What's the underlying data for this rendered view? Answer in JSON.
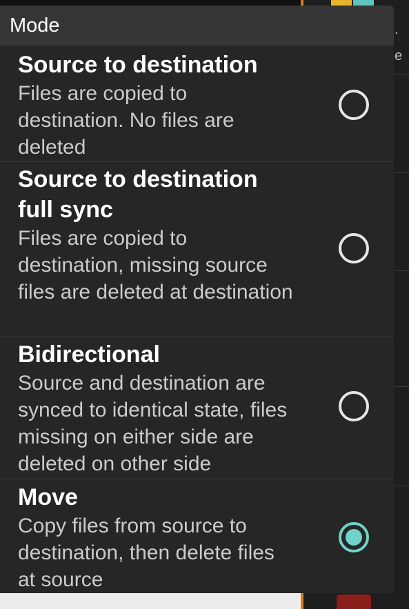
{
  "dialog": {
    "title": "Mode"
  },
  "options": [
    {
      "title": "Source to destination",
      "description": "Files are copied to destination. No files are deleted",
      "selected": false
    },
    {
      "title": "Source to destination full sync",
      "description": "Files are copied to destination, missing source files are deleted at destination",
      "selected": false
    },
    {
      "title": "Bidirectional",
      "description": "Source and destination are synced to identical state, files missing on either side are deleted on other side",
      "selected": false
    },
    {
      "title": "Move",
      "description": "Copy files from source to destination, then delete files at source",
      "selected": true
    }
  ],
  "background": {
    "char_1": ".",
    "char_2": "e"
  },
  "colors": {
    "accent": "#6fd3c9",
    "dialog_bg": "#262626",
    "header_bg": "#363636",
    "orange_line": "#e07a16"
  }
}
